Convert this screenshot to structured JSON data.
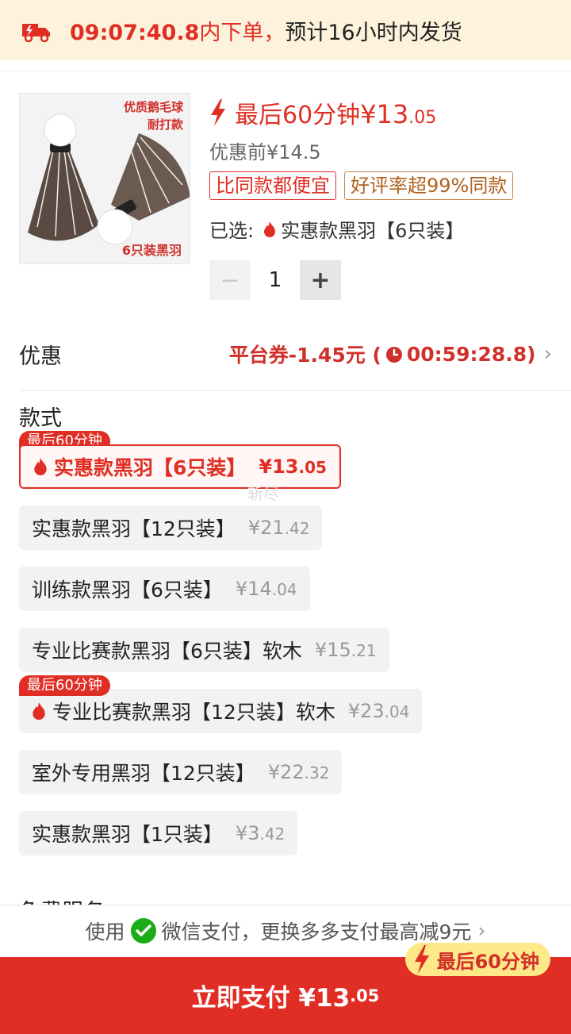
{
  "banner": {
    "time": "09:07:40.8",
    "middle": "内下单，",
    "rest_prefix": "预计",
    "hours": "16",
    "rest_suffix": "小时内发货",
    "icon": "truck-icon"
  },
  "product": {
    "image_tag_top_line1": "优质鹅毛球",
    "image_tag_top_line2": "耐打款",
    "image_tag_bottom": "6只装黑羽",
    "price_label": "最后60分钟",
    "price_main": "¥13",
    "price_small": ".05",
    "original_price": "优惠前¥14.5",
    "tags": [
      "比同款都便宜",
      "好评率超99%同款"
    ],
    "selected_prefix": "已选:",
    "selected_value": "实惠款黑羽【6只装】",
    "quantity": "1"
  },
  "coupon": {
    "title": "优惠",
    "value_prefix": "平台券-1.45元 (",
    "countdown": "00:59:28.8",
    "value_suffix": ")"
  },
  "style_section": {
    "title": "款式",
    "badge": "最后60分钟",
    "ghost_text": "斩尽",
    "options": [
      {
        "label": "实惠款黑羽【6只装】",
        "price_main": "¥13",
        "price_small": ".05"
      },
      {
        "label": "实惠款黑羽【12只装】",
        "price_main": "¥21",
        "price_small": ".42"
      },
      {
        "label": "训练款黑羽【6只装】",
        "price_main": "¥14",
        "price_small": ".04"
      },
      {
        "label": "专业比赛款黑羽【6只装】软木",
        "price_main": "¥15",
        "price_small": ".21"
      },
      {
        "label": "专业比赛款黑羽【12只装】软木",
        "price_main": "¥23",
        "price_small": ".04"
      },
      {
        "label": "室外专用黑羽【12只装】",
        "price_main": "¥22",
        "price_small": ".32"
      },
      {
        "label": "实惠款黑羽【1只装】",
        "price_main": "¥3",
        "price_small": ".42"
      }
    ]
  },
  "cut_section_title": "免费服务",
  "payment": {
    "prefix": "使用",
    "method": "微信支付，更换多多支付最高减9元",
    "chevron": "›"
  },
  "promo_badge": "最后60分钟",
  "cta": {
    "label": "立即支付 ¥13",
    "small": ".05"
  },
  "colors": {
    "accent": "#e02e24",
    "banner_bg": "#fdf3dc",
    "promo_bg": "#fde88a"
  }
}
